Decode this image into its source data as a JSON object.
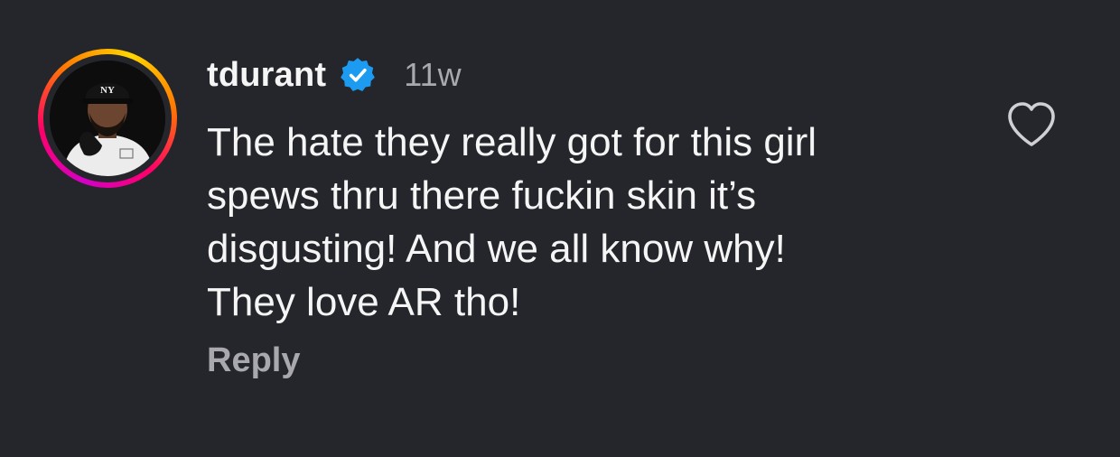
{
  "comment": {
    "author": "tdurant",
    "verified_icon": "verified-badge-icon",
    "timestamp": "11w",
    "text": "The hate they really got for this girl\nspews thru there fuckin skin it’s\ndisgusting! And we all know why!\nThey love AR tho!",
    "reply_label": "Reply",
    "like_icon": "heart-outline-icon"
  },
  "colors": {
    "background": "#25262b",
    "text": "#f5f5f5",
    "muted": "#a8a8ad",
    "verified": "#1d9bf0"
  },
  "avatar": {
    "cap_text": "NY"
  }
}
